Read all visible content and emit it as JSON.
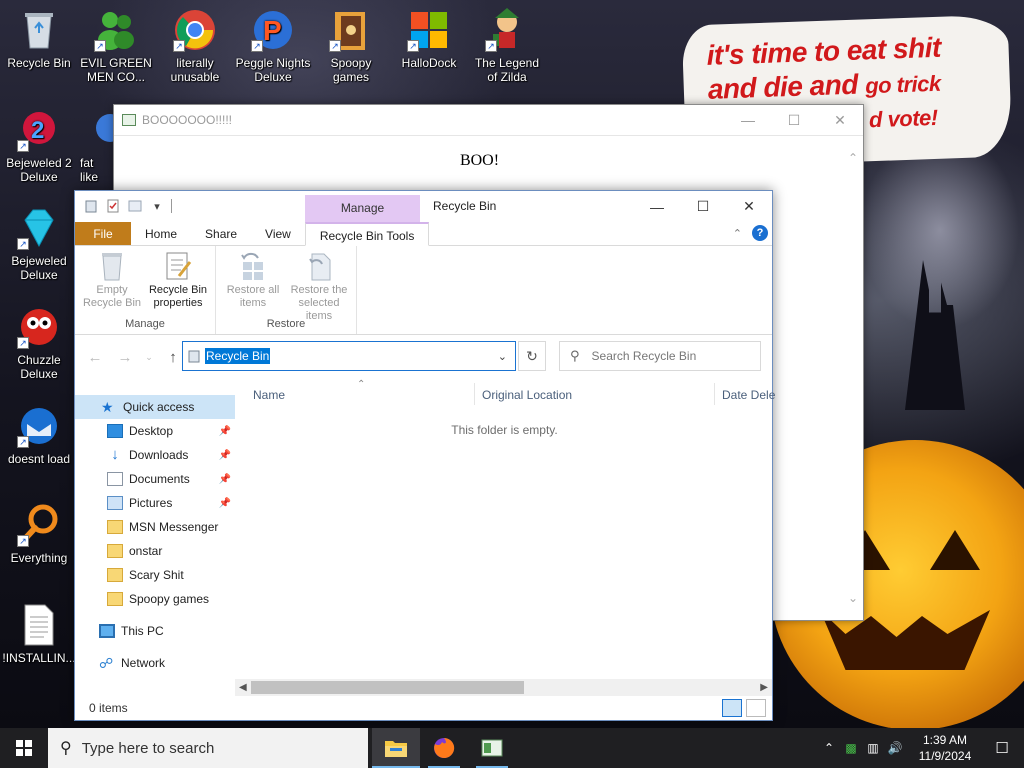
{
  "desktop": {
    "note_line1": "it's time to eat shit",
    "note_line2a": "and die and",
    "note_line2b": "go trick",
    "note_line3": "d vote!",
    "icons": [
      {
        "label": "Recycle Bin"
      },
      {
        "label": "EVIL GREEN MEN CO..."
      },
      {
        "label": "literally unusable"
      },
      {
        "label": "Peggle Nights Deluxe"
      },
      {
        "label": "Spoopy games"
      },
      {
        "label": "HalloDock"
      },
      {
        "label": "The Legend of Zilda"
      },
      {
        "label": "Bejeweled 2 Deluxe"
      },
      {
        "label": "fat like"
      },
      {
        "label": "Bejeweled Deluxe"
      },
      {
        "label": "Chuzzle Deluxe"
      },
      {
        "label": "doesnt load"
      },
      {
        "label": "Everything"
      },
      {
        "label": "!INSTALLIN..."
      }
    ]
  },
  "boo_window": {
    "title": "BOOOOOOO!!!!!",
    "body": "BOO!"
  },
  "explorer": {
    "title": "Recycle Bin",
    "context_tab": "Manage",
    "tabs": [
      "File",
      "Home",
      "Share",
      "View",
      "Recycle Bin Tools"
    ],
    "ribbon": {
      "manage_group": "Manage",
      "restore_group": "Restore",
      "empty_btn": "Empty Recycle Bin",
      "props_btn": "Recycle Bin properties",
      "restore_all_btn": "Restore all items",
      "restore_sel_btn": "Restore the selected items"
    },
    "address": "Recycle Bin",
    "search_placeholder": "Search Recycle Bin",
    "nav": {
      "quick_access": "Quick access",
      "pinned": [
        "Desktop",
        "Downloads",
        "Documents",
        "Pictures"
      ],
      "folders": [
        "MSN Messenger",
        "onstar",
        "Scary Shit",
        "Spoopy games"
      ],
      "this_pc": "This PC",
      "network": "Network"
    },
    "columns": {
      "name": "Name",
      "original_location": "Original Location",
      "date_deleted": "Date Dele"
    },
    "empty_message": "This folder is empty.",
    "status": "0 items"
  },
  "taskbar": {
    "search_placeholder": "Type here to search",
    "time": "1:39 AM",
    "date": "11/9/2024"
  }
}
